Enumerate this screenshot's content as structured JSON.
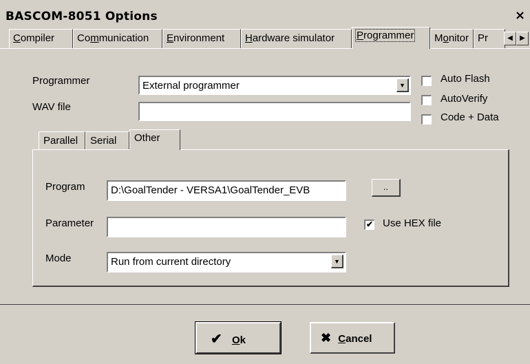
{
  "window": {
    "title": "BASCOM-8051 Options",
    "close_glyph": "×"
  },
  "tabs": [
    {
      "label_pre": "",
      "accel": "C",
      "label_post": "ompiler"
    },
    {
      "label_pre": "Co",
      "accel": "m",
      "label_post": "munication"
    },
    {
      "label_pre": "",
      "accel": "E",
      "label_post": "nvironment"
    },
    {
      "label_pre": "",
      "accel": "H",
      "label_post": "ardware simulator"
    },
    {
      "label_pre": "",
      "accel": "P",
      "label_post": "rogrammer"
    },
    {
      "label_pre": "M",
      "accel": "o",
      "label_post": "nitor"
    },
    {
      "label_pre": "Pr",
      "accel": "",
      "label_post": ""
    }
  ],
  "programmer": {
    "programmer_label": "Programmer",
    "programmer_value": "External programmer",
    "wav_label": "WAV file",
    "wav_value": "",
    "auto_flash_label": "Auto Flash",
    "auto_flash_checked": false,
    "auto_verify_label": "AutoVerify",
    "auto_verify_checked": false,
    "code_data_label": "Code + Data",
    "code_data_checked": false
  },
  "inner_tabs": [
    "Parallel",
    "Serial",
    "Other"
  ],
  "other": {
    "program_label": "Program",
    "program_value": "D:\\GoalTender - VERSA1\\GoalTender_EVB",
    "browse_label": "..",
    "parameter_label": "Parameter",
    "parameter_value": "",
    "use_hex_label": "Use HEX file",
    "use_hex_checked": true,
    "check_glyph": "✔",
    "mode_label": "Mode",
    "mode_value": "Run from current directory"
  },
  "footer": {
    "ok_accel": "O",
    "ok_rest": "k",
    "ok_glyph": "✔",
    "cancel_accel": "C",
    "cancel_rest": "ancel",
    "cancel_glyph": "✖"
  }
}
